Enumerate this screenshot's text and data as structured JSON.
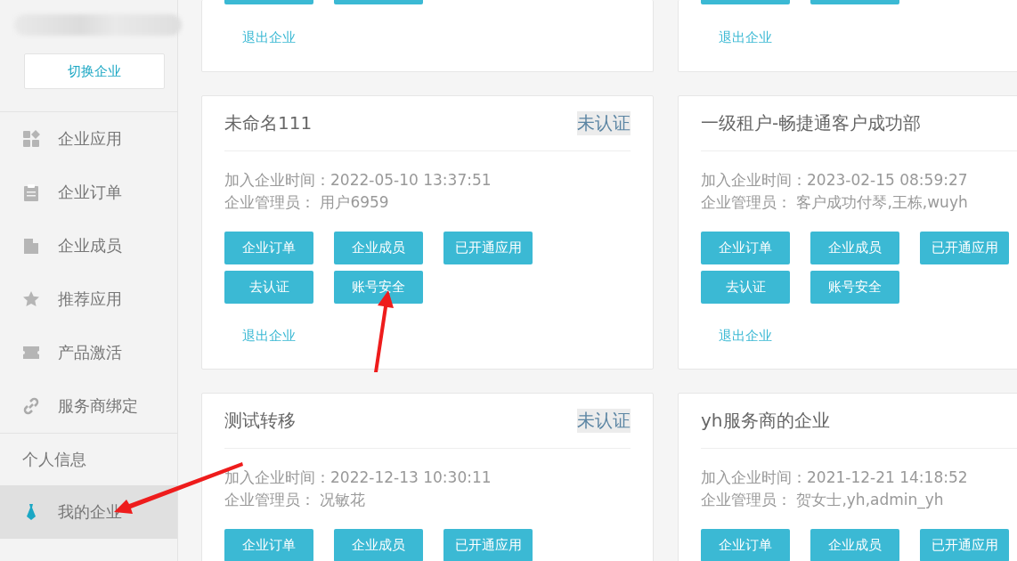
{
  "sidebar": {
    "switch_button": "切换企业",
    "items": [
      {
        "kind": "nav",
        "label": "企业应用",
        "selected": false
      },
      {
        "kind": "nav",
        "label": "企业订单",
        "selected": false
      },
      {
        "kind": "nav",
        "label": "企业成员",
        "selected": false
      },
      {
        "kind": "nav",
        "label": "推荐应用",
        "selected": false
      },
      {
        "kind": "nav",
        "label": "产品激活",
        "selected": false
      },
      {
        "kind": "nav",
        "label": "服务商绑定",
        "selected": false
      },
      {
        "kind": "header",
        "label": "个人信息"
      },
      {
        "kind": "nav",
        "label": "我的企业",
        "selected": true
      }
    ]
  },
  "cards": [
    {
      "kind": "cut",
      "exit_link": "退出企业"
    },
    {
      "kind": "cut",
      "exit_link": "退出企业"
    },
    {
      "kind": "full",
      "name": "未命名111",
      "status": "未认证",
      "join_time": "加入企业时间：2022-05-10 13:37:51",
      "admins": "企业管理员：  用户6959",
      "buttons": [
        "企业订单",
        "企业成员",
        "已开通应用",
        "去认证",
        "账号安全"
      ],
      "exit_link": "退出企业"
    },
    {
      "kind": "full",
      "name": "一级租户-畅捷通客户成功部",
      "join_time": "加入企业时间：2023-02-15 08:59:27",
      "admins": "企业管理员：  客户成功付琴,王栋,wuyh",
      "buttons": [
        "企业订单",
        "企业成员",
        "已开通应用",
        "去认证",
        "账号安全"
      ],
      "exit_link": "退出企业"
    },
    {
      "kind": "full",
      "name": "测试转移",
      "status": "未认证",
      "join_time": "加入企业时间：2022-12-13 10:30:11",
      "admins": "企业管理员：  况敏花",
      "buttons": [
        "企业订单",
        "企业成员",
        "已开通应用"
      ]
    },
    {
      "kind": "full",
      "name": "yh服务商的企业",
      "join_time": "加入企业时间：2021-12-21 14:18:52",
      "admins": "企业管理员：  贺女士,yh,admin_yh",
      "buttons": [
        "企业订单",
        "企业成员",
        "已开通应用"
      ]
    }
  ]
}
